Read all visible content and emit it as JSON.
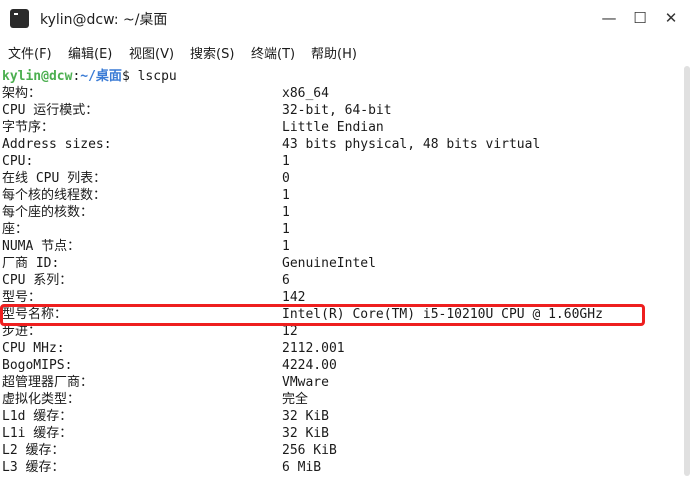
{
  "window": {
    "title": "kylin@dcw: ~/桌面",
    "controls": {
      "minimize": "—",
      "maximize": "☐",
      "close": "✕"
    }
  },
  "menu": [
    {
      "label": "文件(F)"
    },
    {
      "label": "编辑(E)"
    },
    {
      "label": "视图(V)"
    },
    {
      "label": "搜索(S)"
    },
    {
      "label": "终端(T)"
    },
    {
      "label": "帮助(H)"
    }
  ],
  "prompt": {
    "user": "kylin@dcw",
    "sep": ":",
    "path": "~/桌面",
    "symbol": "$ ",
    "command": "lscpu"
  },
  "output": [
    {
      "key": "架构：",
      "value": "x86_64"
    },
    {
      "key": "CPU 运行模式：",
      "value": "32-bit, 64-bit"
    },
    {
      "key": "字节序：",
      "value": "Little Endian"
    },
    {
      "key": "Address sizes:",
      "value": "43 bits physical, 48 bits virtual"
    },
    {
      "key": "CPU:",
      "value": "1"
    },
    {
      "key": "在线 CPU 列表：",
      "value": "0"
    },
    {
      "key": "每个核的线程数：",
      "value": "1"
    },
    {
      "key": "每个座的核数：",
      "value": "1"
    },
    {
      "key": "座：",
      "value": "1"
    },
    {
      "key": "NUMA 节点：",
      "value": "1"
    },
    {
      "key": "厂商 ID:",
      "value": "GenuineIntel"
    },
    {
      "key": "CPU 系列：",
      "value": "6"
    },
    {
      "key": "型号：",
      "value": "142"
    },
    {
      "key": "型号名称：",
      "value": "Intel(R) Core(TM) i5-10210U CPU @ 1.60GHz"
    },
    {
      "key": "步进：",
      "value": "12"
    },
    {
      "key": "CPU MHz:",
      "value": "2112.001"
    },
    {
      "key": "BogoMIPS:",
      "value": "4224.00"
    },
    {
      "key": "超管理器厂商：",
      "value": "VMware"
    },
    {
      "key": "虚拟化类型：",
      "value": "完全"
    },
    {
      "key": "L1d 缓存：",
      "value": "32 KiB"
    },
    {
      "key": "L1i 缓存：",
      "value": "32 KiB"
    },
    {
      "key": "L2 缓存：",
      "value": "256 KiB"
    },
    {
      "key": "L3 缓存：",
      "value": "6 MiB"
    }
  ],
  "colors": {
    "highlight": "#ee1f1f",
    "prompt_user": "#4caf50",
    "prompt_path": "#3a7bd5"
  }
}
